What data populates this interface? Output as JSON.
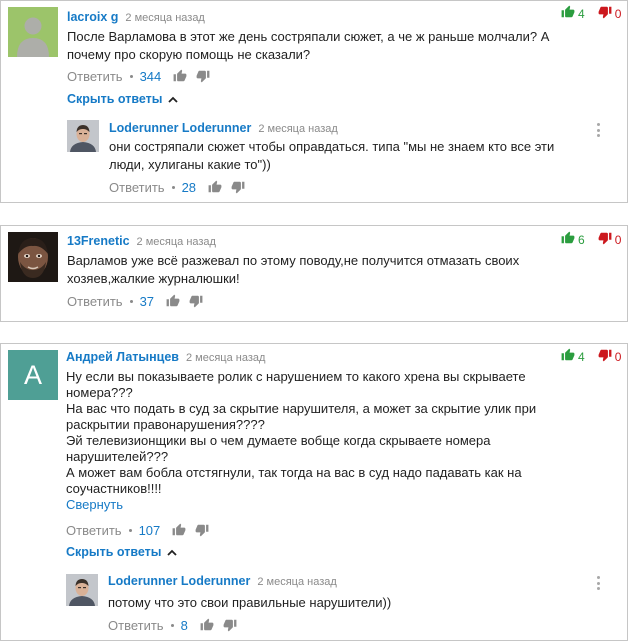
{
  "comments": [
    {
      "author": "lacroix g",
      "time": "2 месяца назад",
      "likes": "4",
      "dislikes": "0",
      "body_lines": [
        "После Варламова в этот же день состряпали сюжет, а че ж раньше молчали? А",
        "почему про скорую помощь не сказали?"
      ],
      "reply_label": "Ответить",
      "like_count": "344",
      "toggle_replies": "Скрыть ответы",
      "replies": [
        {
          "author": "Loderunner Loderunner",
          "time": "2 месяца назад",
          "body_lines": [
            "они состряпали сюжет чтобы оправдаться. типа \"мы не знаем кто все эти",
            "люди, хулиганы какие то\"))"
          ],
          "reply_label": "Ответить",
          "like_count": "28"
        }
      ]
    },
    {
      "author": "13Frenetic",
      "time": "2 месяца назад",
      "likes": "6",
      "dislikes": "0",
      "body_lines": [
        "Варламов уже всё разжевал по этому поводу,не получится отмазать своих",
        "хозяев,жалкие журналюшки!"
      ],
      "reply_label": "Ответить",
      "like_count": "37"
    },
    {
      "author": "Андрей Латынцев",
      "avatar_letter": "A",
      "time": "2 месяца назад",
      "likes": "4",
      "dislikes": "0",
      "body_lines": [
        "Ну если вы показываете ролик с нарушением то какого хрена вы скрываете",
        "номера???",
        "На вас что подать в суд за скрытие нарушителя, а может за скрытие улик при",
        "раскрытии правонарушения????",
        "Эй телевизионщики вы о чем думаете вобще когда скрываете номера",
        "нарушителей???",
        "А может вам бобла отстягнули, так тогда на вас в суд надо падавать как на",
        "соучастников!!!!"
      ],
      "collapse_label": "Свернуть",
      "reply_label": "Ответить",
      "like_count": "107",
      "toggle_replies": "Скрыть ответы",
      "replies": [
        {
          "author": "Loderunner Loderunner",
          "time": "2 месяца назад",
          "body_lines": [
            "потому что это свои правильные нарушители))"
          ],
          "reply_label": "Ответить",
          "like_count": "8"
        }
      ]
    }
  ],
  "colors": {
    "link_blue": "#167ac6",
    "like_green": "#2b9d3f",
    "dislike_red": "#cc181e",
    "muted_gray": "#8a8a8a",
    "letter_avatar_teal": "#4f9f95"
  },
  "icons": [
    "thumbs-up-icon",
    "thumbs-down-icon",
    "kebab-menu-icon",
    "chevron-up-icon",
    "default-user-icon"
  ]
}
